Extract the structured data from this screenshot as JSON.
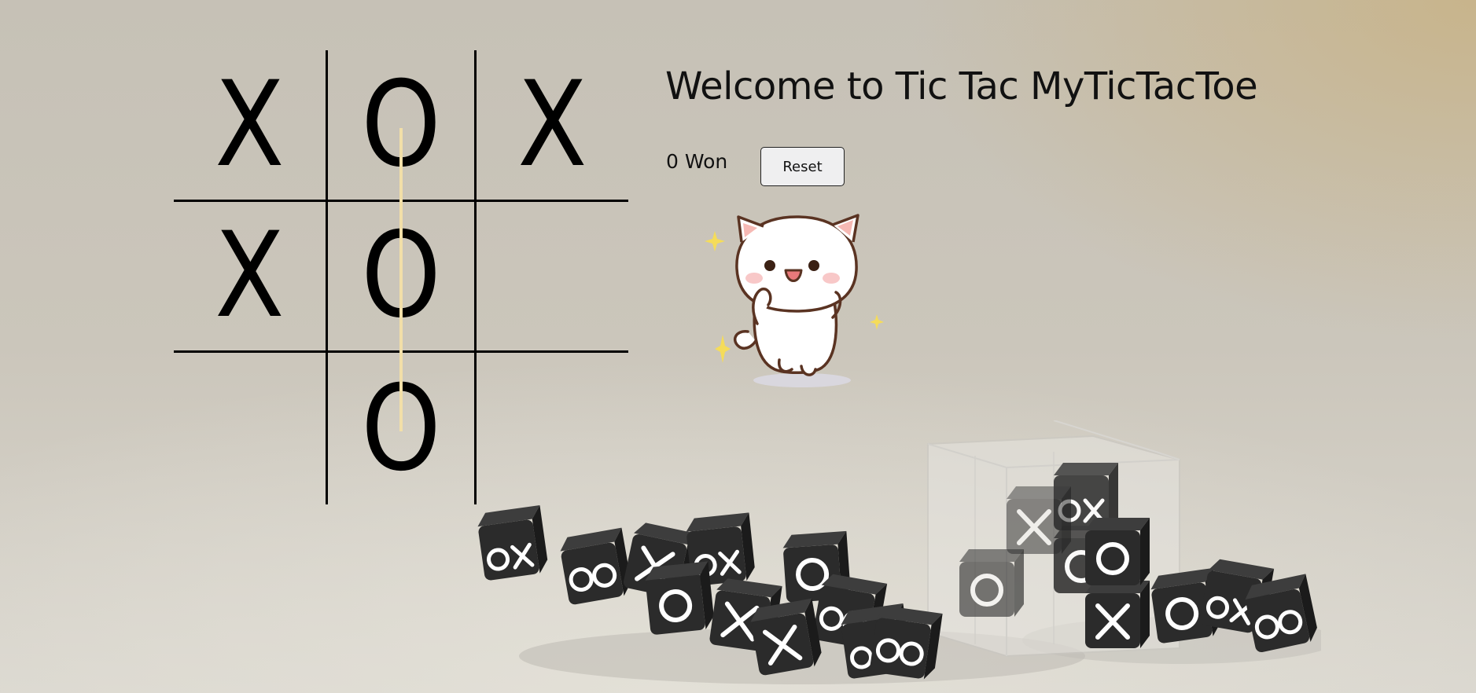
{
  "board": {
    "cells": [
      "X",
      "O",
      "X",
      "X",
      "O",
      "",
      "",
      "O",
      ""
    ]
  },
  "title": "Welcome to Tic Tac MyTicTacToe",
  "status": "0 Won",
  "reset_label": "Reset",
  "colors": {
    "win_line": "#f2dfa8",
    "text": "#111111",
    "sparkle": "#f5dc5a"
  },
  "icons": {
    "sticker": "happy-cat-sticker",
    "background": "tic-tac-toe-dice-illustration"
  }
}
